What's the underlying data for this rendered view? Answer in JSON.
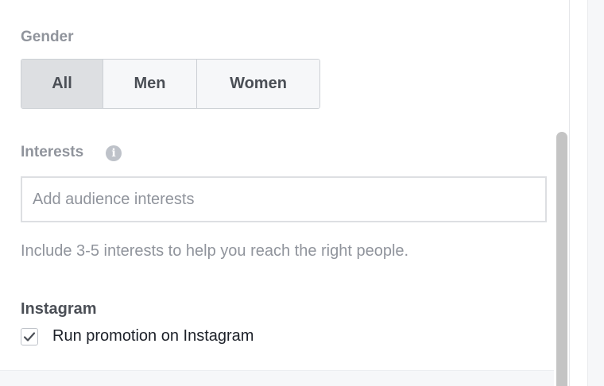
{
  "gender": {
    "label": "Gender",
    "options": [
      "All",
      "Men",
      "Women"
    ],
    "selected": "All"
  },
  "interests": {
    "label": "Interests",
    "info_icon": "info-icon",
    "input_placeholder": "Add audience interests",
    "input_value": "",
    "hint": "Include 3-5 interests to help you reach the right people."
  },
  "instagram": {
    "label": "Instagram",
    "checkbox_label": "Run promotion on Instagram",
    "checked": true
  },
  "colors": {
    "muted_text": "#90949c",
    "active_segment": "#dddfe2",
    "segment_bg": "#f6f7f9",
    "scrollbar_thumb": "#c4c4c4"
  }
}
